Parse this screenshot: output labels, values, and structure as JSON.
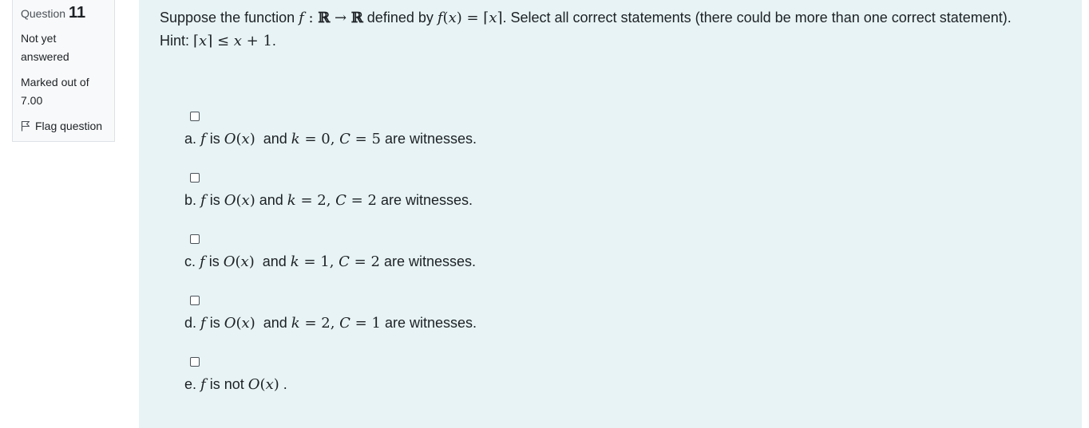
{
  "info": {
    "question_label": "Question",
    "question_number": "11",
    "state_line1": "Not yet",
    "state_line2": "answered",
    "grade_line1": "Marked out of",
    "grade_line2": "7.00",
    "flag_label": "Flag question"
  },
  "question": {
    "text_1": "Suppose the function ",
    "text_2": " defined by ",
    "text_3": ". Select all correct statements (there could be more than one correct statement). Hint: ",
    "text_4": "."
  },
  "options": [
    {
      "letter": "a.",
      "checked": false,
      "is_text": "is",
      "and_text": "and",
      "k": "0",
      "C": "5",
      "tail": "are witnesses."
    },
    {
      "letter": "b.",
      "checked": false,
      "is_text": "is",
      "and_text": "and",
      "k": "2",
      "C": "2",
      "tail": "are witnesses."
    },
    {
      "letter": "c.",
      "checked": false,
      "is_text": "is",
      "and_text": "and",
      "k": "1",
      "C": "2",
      "tail": "are witnesses."
    },
    {
      "letter": "d.",
      "checked": false,
      "is_text": "is",
      "and_text": "and",
      "k": "2",
      "C": "1",
      "tail": "are witnesses."
    },
    {
      "letter": "e.",
      "checked": false,
      "is_text": "is not",
      "tail": "."
    }
  ]
}
